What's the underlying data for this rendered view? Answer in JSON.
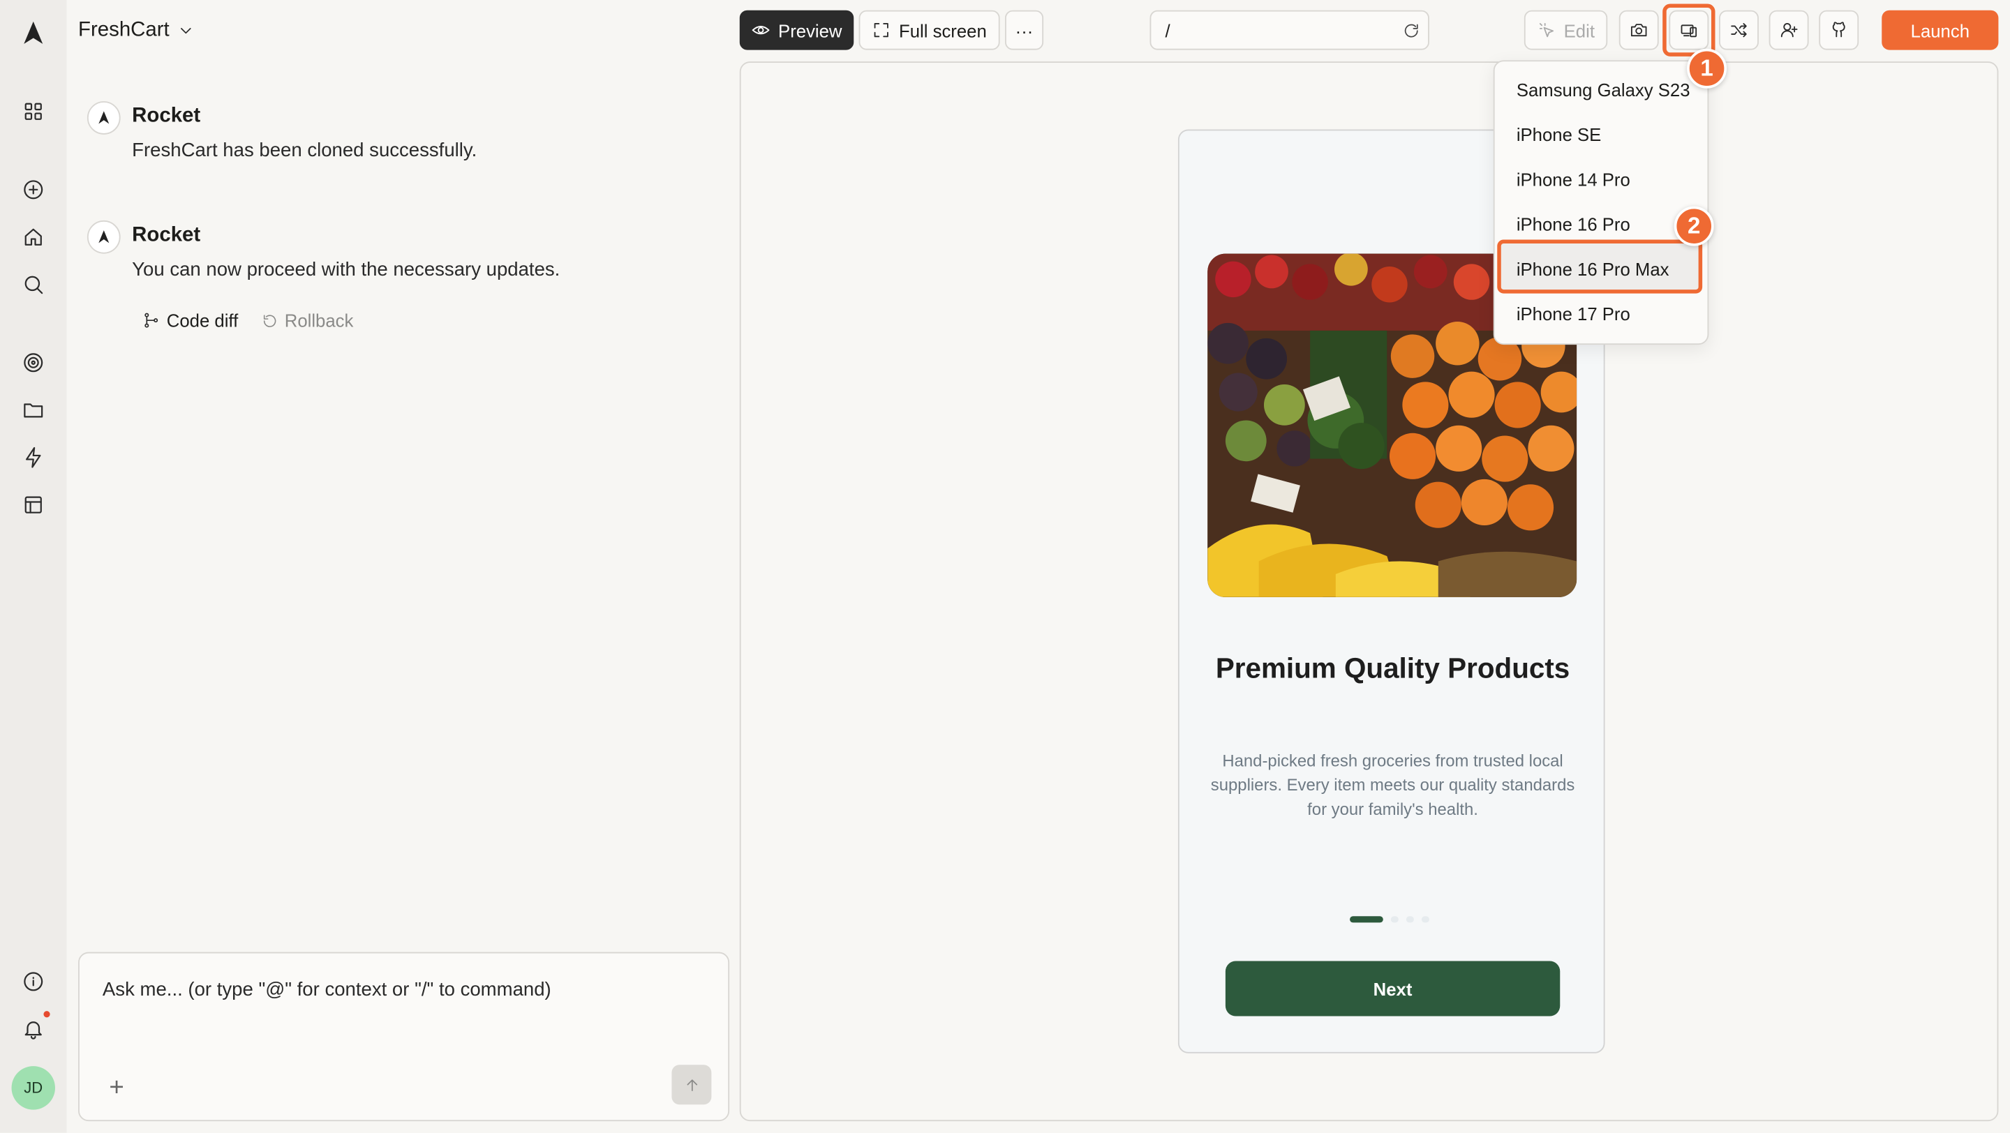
{
  "app": {
    "project_name": "FreshCart",
    "user_initials": "JD"
  },
  "rail": {
    "icons": [
      "rocket-logo-icon",
      "grid-icon",
      "plus-circle-icon",
      "home-icon",
      "search-icon",
      "target-icon",
      "folder-icon",
      "bolt-icon",
      "layout-icon",
      "info-icon",
      "bell-icon"
    ]
  },
  "chat": {
    "messages": [
      {
        "author": "Rocket",
        "text": "FreshCart has been cloned successfully."
      },
      {
        "author": "Rocket",
        "text": "You can now proceed with the necessary updates."
      }
    ],
    "actions": {
      "code_diff": "Code diff",
      "rollback": "Rollback"
    },
    "input_placeholder": "Ask me... (or type \"@\" for context or \"/\" to command)"
  },
  "toolbar": {
    "preview": "Preview",
    "full_screen": "Full screen",
    "more": "···",
    "url_path": "/",
    "edit": "Edit",
    "launch": "Launch"
  },
  "device_menu": {
    "items": [
      "Samsung Galaxy S23",
      "iPhone SE",
      "iPhone 14 Pro",
      "iPhone 16 Pro",
      "iPhone 16 Pro Max",
      "iPhone 17 Pro"
    ],
    "highlighted": "iPhone 16 Pro Max"
  },
  "annotations": {
    "badge_1": "1",
    "badge_2": "2"
  },
  "phone_preview": {
    "title": "Premium Quality Products",
    "subtitle": "Hand-picked fresh groceries from trusted local suppliers. Every item meets our quality standards for your family's health.",
    "next_label": "Next",
    "onboarding_step": 1,
    "onboarding_total": 4
  },
  "colors": {
    "accent": "#ef6a33",
    "brand_green": "#2d5a3d",
    "rail_bg": "#eeece9",
    "page_bg": "#f7f6f3"
  }
}
